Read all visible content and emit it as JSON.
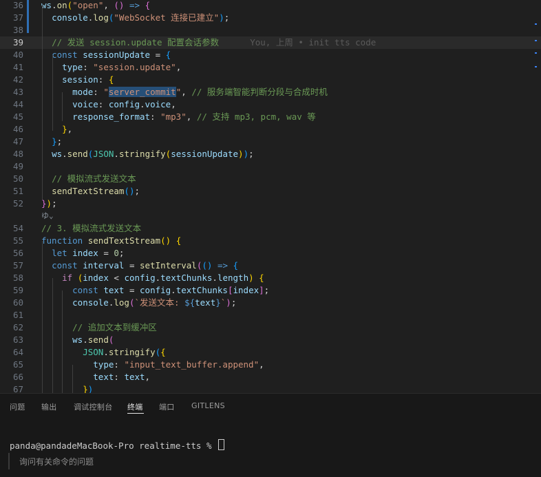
{
  "editor": {
    "lines": [
      {
        "n": "36",
        "html": "<span class=\"v\">ws</span>.<span class=\"f\">on</span><span class=\"b1\">(</span><span class=\"s\">\"open\"</span>, <span class=\"b2\">()</span> <span class=\"k\">=&gt;</span> <span class=\"b2\">{</span>"
      },
      {
        "n": "37",
        "html": "  <span class=\"v\">console</span>.<span class=\"f\">log</span><span class=\"b3\">(</span><span class=\"s\">\"WebSocket 连接已建立\"</span><span class=\"b3\">)</span>;"
      },
      {
        "n": "38",
        "html": ""
      },
      {
        "n": "39",
        "html": "  <span class=\"c\">// 发送 session.update 配置会话参数</span>      <span class=\"blame\">You, 上周 • init tts code</span>"
      },
      {
        "n": "40",
        "html": "  <span class=\"k\">const</span> <span class=\"v\">sessionUpdate</span> = <span class=\"b3\">{</span>"
      },
      {
        "n": "41",
        "html": "    <span class=\"v\">type</span>: <span class=\"s\">\"session.update\"</span>,"
      },
      {
        "n": "42",
        "html": "    <span class=\"v\">session</span>: <span class=\"b1\">{</span>"
      },
      {
        "n": "43",
        "html": "      <span class=\"v\">mode</span>: <span class=\"s\">\"<span class=\"hl\">server_commit</span>\"</span>, <span class=\"c\">// 服务端智能判断分段与合成时机</span>"
      },
      {
        "n": "44",
        "html": "      <span class=\"v\">voice</span>: <span class=\"v\">config</span>.<span class=\"v\">voice</span>,"
      },
      {
        "n": "45",
        "html": "      <span class=\"v\">response_format</span>: <span class=\"s\">\"mp3\"</span>, <span class=\"c\">// 支持 mp3, pcm, wav 等</span>"
      },
      {
        "n": "46",
        "html": "    <span class=\"b1\">}</span>,"
      },
      {
        "n": "47",
        "html": "  <span class=\"b3\">}</span>;"
      },
      {
        "n": "48",
        "html": "  <span class=\"v\">ws</span>.<span class=\"f\">send</span><span class=\"b3\">(</span><span class=\"t\">JSON</span>.<span class=\"f\">stringify</span><span class=\"b1\">(</span><span class=\"v\">sessionUpdate</span><span class=\"b1\">)</span><span class=\"b3\">)</span>;"
      },
      {
        "n": "49",
        "html": ""
      },
      {
        "n": "50",
        "html": "  <span class=\"c\">// 模拟流式发送文本</span>"
      },
      {
        "n": "51",
        "html": "  <span class=\"f\">sendTextStream</span><span class=\"b3\">()</span>;"
      },
      {
        "n": "52",
        "html": "<span class=\"b2\">}</span><span class=\"b1\">)</span>;"
      },
      {
        "n": "",
        "html": ""
      },
      {
        "n": "54",
        "html": "<span class=\"c\">// 3. 模拟流式发送文本</span>"
      },
      {
        "n": "55",
        "html": "<span class=\"k\">function</span> <span class=\"f\">sendTextStream</span><span class=\"b1\">()</span> <span class=\"b1\">{</span>"
      },
      {
        "n": "56",
        "html": "  <span class=\"k\">let</span> <span class=\"v\">index</span> = <span class=\"n\">0</span>;"
      },
      {
        "n": "57",
        "html": "  <span class=\"k\">const</span> <span class=\"v\">interval</span> = <span class=\"f\">setInterval</span><span class=\"b2\">(</span><span class=\"b3\">()</span> <span class=\"k\">=&gt;</span> <span class=\"b3\">{</span>"
      },
      {
        "n": "58",
        "html": "    <span class=\"kc\">if</span> <span class=\"b1\">(</span><span class=\"v\">index</span> &lt; <span class=\"v\">config</span>.<span class=\"v\">textChunks</span>.<span class=\"v\">length</span><span class=\"b1\">)</span> <span class=\"b1\">{</span>"
      },
      {
        "n": "59",
        "html": "      <span class=\"k\">const</span> <span class=\"v\">text</span> = <span class=\"v\">config</span>.<span class=\"v\">textChunks</span><span class=\"b2\">[</span><span class=\"v\">index</span><span class=\"b2\">]</span>;"
      },
      {
        "n": "60",
        "html": "      <span class=\"v\">console</span>.<span class=\"f\">log</span><span class=\"b2\">(</span><span class=\"s\">`发送文本: </span><span class=\"k\">${</span><span class=\"v\">text</span><span class=\"k\">}</span><span class=\"s\">`</span><span class=\"b2\">)</span>;"
      },
      {
        "n": "61",
        "html": ""
      },
      {
        "n": "62",
        "html": "      <span class=\"c\">// 追加文本到缓冲区</span>"
      },
      {
        "n": "63",
        "html": "      <span class=\"v\">ws</span>.<span class=\"f\">send</span><span class=\"b2\">(</span>"
      },
      {
        "n": "64",
        "html": "        <span class=\"t\">JSON</span>.<span class=\"f\">stringify</span><span class=\"b3\">(</span><span class=\"b1\">{</span>"
      },
      {
        "n": "65",
        "html": "          <span class=\"v\">type</span>: <span class=\"s\">\"input_text_buffer.append\"</span>,"
      },
      {
        "n": "66",
        "html": "          <span class=\"v\">text</span>: <span class=\"v\">text</span>,"
      },
      {
        "n": "67",
        "html": "        <span class=\"b1\">}</span><span class=\"b3\">)</span>"
      }
    ],
    "fold_marker": "ゆ⌄"
  },
  "panel": {
    "tabs": [
      "问题",
      "输出",
      "调试控制台",
      "终端",
      "端口",
      "GITLENS"
    ],
    "active_tab": "终端",
    "terminal_prompt": "panda@pandadeMacBook-Pro realtime-tts % ",
    "ask_placeholder": "询问有关命令的问题"
  },
  "colors": {
    "editor_bg": "#1f1f1f",
    "panel_bg": "#181818",
    "keyword": "#569cd6",
    "string": "#ce9178",
    "comment": "#6a9955"
  }
}
